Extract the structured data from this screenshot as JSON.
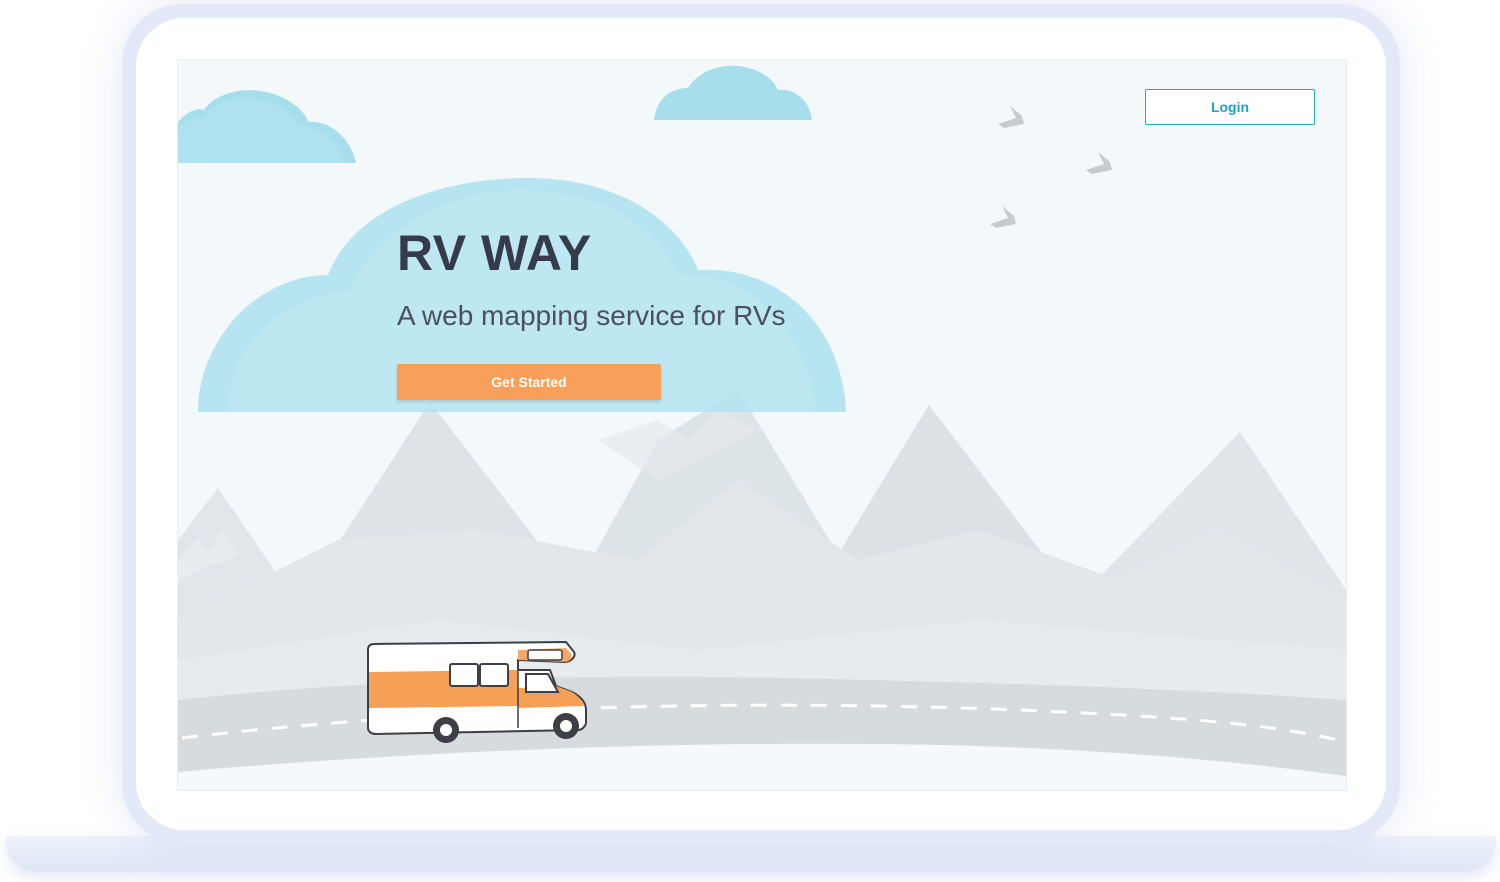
{
  "header": {
    "login_label": "Login"
  },
  "hero": {
    "title": "RV WAY",
    "subtitle": "A web mapping service for RVs",
    "cta_label": "Get Started"
  },
  "colors": {
    "accent_orange": "#f8a05a",
    "login_blue": "#25a8c9",
    "title_dark": "#353a4c",
    "cloud": "#a9e0ee",
    "mountain": "#dde3e6",
    "sky": "#f3f8fb"
  },
  "icons": [
    "cloud-icon",
    "bird-icon",
    "mountain-icon",
    "rv-icon"
  ]
}
